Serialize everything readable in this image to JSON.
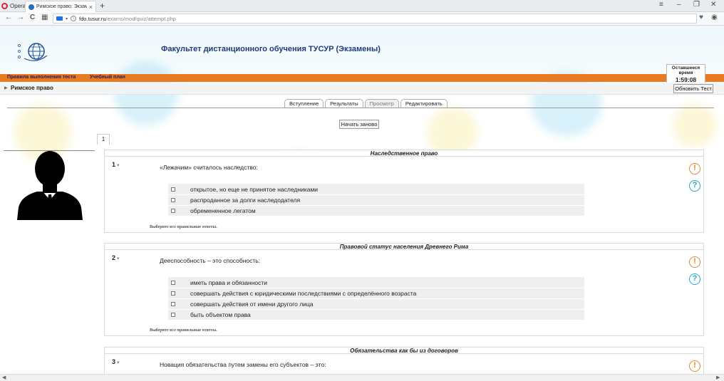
{
  "browser": {
    "menu_label": "Opera",
    "tab_title": "Римское право: Экзамен",
    "tab_close": "×",
    "new_tab": "+",
    "url_host": "fdo.tusur.ru",
    "url_path": "/exams/mod/quiz/attempt.php"
  },
  "header": {
    "site_title": "Факультет дистанционного обучения ТУСУР (Экзамены)"
  },
  "orange_bar": {
    "links": [
      "Правила выполнения теста",
      "Учебный план"
    ]
  },
  "timer": {
    "label": "Оставшееся время",
    "value": "1:59:08"
  },
  "breadcrumb": {
    "course": "Римское право"
  },
  "refresh_button": "Обновить Тест",
  "quiz_tabs": [
    {
      "label": "Вступление",
      "active": false
    },
    {
      "label": "Результаты",
      "active": false
    },
    {
      "label": "Просмотр",
      "active": true
    },
    {
      "label": "Редактировать",
      "active": false
    }
  ],
  "restart_button": "Начать заново",
  "page_number": "1",
  "hint_text": "Выберите все правильные ответы.",
  "questions": [
    {
      "category": "Наследственное право",
      "number": "1",
      "text": "«Лежачим» считалось наследство:",
      "answers": [
        "открытое, но еще не принятое наследниками",
        "распроданное за долги наследодателя",
        "обремененное легатом"
      ]
    },
    {
      "category": "Правовой статус населения Древнего Рима",
      "number": "2",
      "text": "Дееспособность – это способность:",
      "answers": [
        "иметь права и обязанности",
        "совершать действия с юридическими последствиями с определённого возраста",
        "совершать действия от имени другого лица",
        "быть объектом права"
      ]
    },
    {
      "category": "Обязательства как бы из договоров",
      "number": "3",
      "text": "Новация обязательства путем замены его субъектов – это:",
      "answers": []
    }
  ],
  "icons": {
    "warn": "!",
    "help": "?",
    "flag": "▾"
  },
  "colors": {
    "orange_bar": "#e87a22",
    "title": "#1f3b7a",
    "warn": "#e08a2c",
    "help": "#24a6c7"
  }
}
